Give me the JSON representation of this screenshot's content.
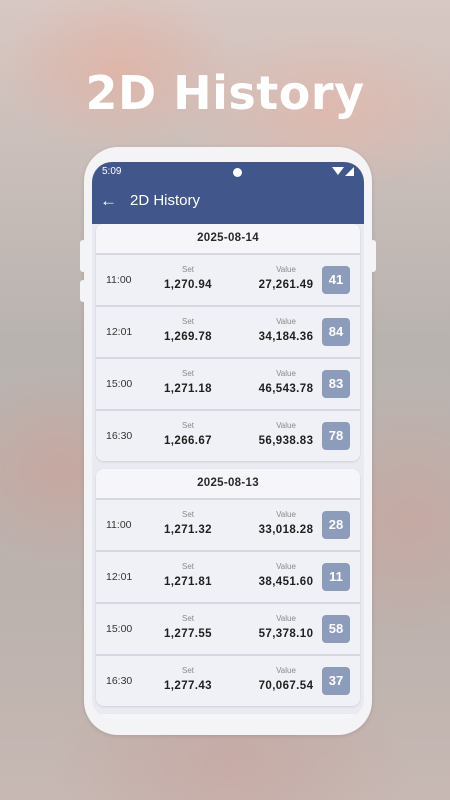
{
  "headline": "2D History",
  "status_bar": {
    "time": "5:09",
    "icons": [
      "wifi-icon",
      "signal-icon"
    ]
  },
  "app_bar": {
    "back_icon": "arrow-left-icon",
    "back_glyph": "←",
    "title": "2D History"
  },
  "labels": {
    "set": "Set",
    "value": "Value"
  },
  "colors": {
    "app_bar": "#41568a",
    "badge": "#8d9cbb"
  },
  "days": [
    {
      "date": "2025-08-14",
      "entries": [
        {
          "time": "11:00",
          "set": "1,270.94",
          "value": "27,261.49",
          "result": "41"
        },
        {
          "time": "12:01",
          "set": "1,269.78",
          "value": "34,184.36",
          "result": "84"
        },
        {
          "time": "15:00",
          "set": "1,271.18",
          "value": "46,543.78",
          "result": "83"
        },
        {
          "time": "16:30",
          "set": "1,266.67",
          "value": "56,938.83",
          "result": "78"
        }
      ]
    },
    {
      "date": "2025-08-13",
      "entries": [
        {
          "time": "11:00",
          "set": "1,271.32",
          "value": "33,018.28",
          "result": "28"
        },
        {
          "time": "12:01",
          "set": "1,271.81",
          "value": "38,451.60",
          "result": "11"
        },
        {
          "time": "15:00",
          "set": "1,277.55",
          "value": "57,378.10",
          "result": "58"
        },
        {
          "time": "16:30",
          "set": "1,277.43",
          "value": "70,067.54",
          "result": "37"
        }
      ]
    }
  ]
}
